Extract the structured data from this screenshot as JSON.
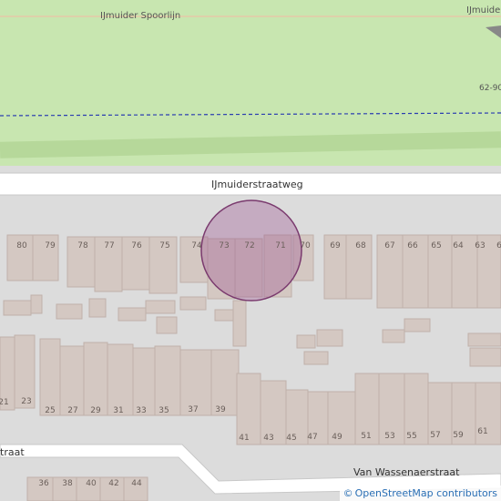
{
  "map": {
    "railway_label": "IJmuider Spoorlijn",
    "railway_label_right": "IJmuide",
    "area_code": "62-90",
    "main_street": "IJmuiderstraatweg",
    "south_street": "Van Wassenaerstraat",
    "west_street_fragment": "traat",
    "marker": {
      "fill": "#9c4f8e",
      "opacity": 0.35,
      "stroke": "#7a3a6e"
    },
    "colors": {
      "green": "#c8e6b0",
      "road": "#ffffff",
      "building": "#d4c8c2",
      "background": "#dcdcdc"
    }
  },
  "house_numbers_north": [
    "80",
    "79",
    "78",
    "77",
    "76",
    "75",
    "74",
    "73",
    "72",
    "71",
    "70",
    "69",
    "68",
    "67",
    "66",
    "65",
    "64",
    "63",
    "6"
  ],
  "house_numbers_south_row": [
    "21",
    "23",
    "25",
    "27",
    "29",
    "31",
    "33",
    "35",
    "37",
    "39"
  ],
  "house_numbers_south_right": [
    "41",
    "43",
    "45",
    "47",
    "49",
    "51",
    "53",
    "55",
    "57",
    "59",
    "61"
  ],
  "house_numbers_bottom": [
    "36",
    "38",
    "40",
    "42",
    "44"
  ],
  "attribution": {
    "symbol": "©",
    "text": "OpenStreetMap contributors"
  }
}
